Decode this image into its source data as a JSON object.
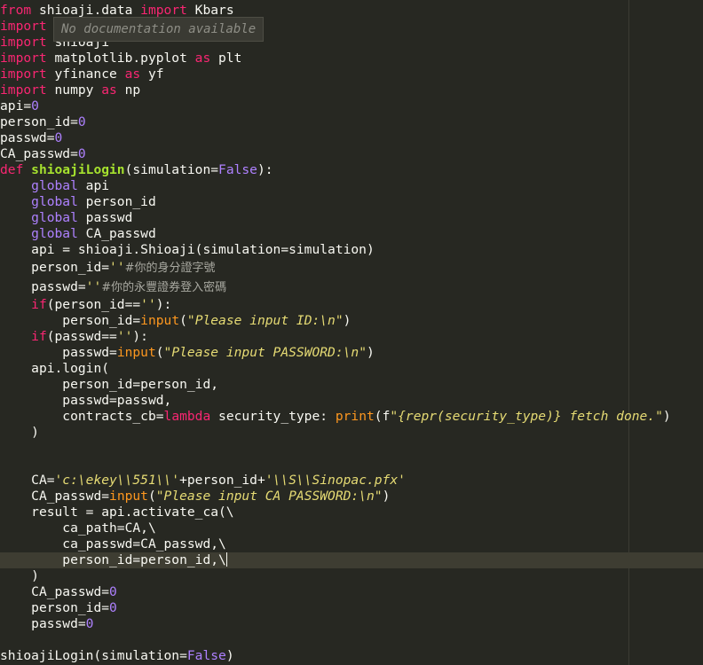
{
  "tooltip": "No documentation available",
  "code": {
    "l1": {
      "a": "from",
      "b": " shioaji.data ",
      "c": "import",
      "d": " Kbars"
    },
    "l2": {
      "a": "import"
    },
    "l3": {
      "a": "import",
      "b": " shioaji"
    },
    "l4": {
      "a": "import",
      "b": " matplotlib.pyplot ",
      "c": "as",
      "d": " plt"
    },
    "l5": {
      "a": "import",
      "b": " yfinance ",
      "c": "as",
      "d": " yf"
    },
    "l6": {
      "a": "import",
      "b": " numpy ",
      "c": "as",
      "d": " np"
    },
    "l7": {
      "a": "api=",
      "b": "0"
    },
    "l8": {
      "a": "person_id=",
      "b": "0"
    },
    "l9": {
      "a": "passwd=",
      "b": "0"
    },
    "l10": {
      "a": "CA_passwd=",
      "b": "0"
    },
    "l11": {
      "a": "def",
      "b": "shioajiLogin",
      "c": "(simulation=",
      "d": "False",
      "e": "):"
    },
    "l12": {
      "a": "global",
      "b": " api"
    },
    "l13": {
      "a": "global",
      "b": " person_id"
    },
    "l14": {
      "a": "global",
      "b": " passwd"
    },
    "l15": {
      "a": "global",
      "b": " CA_passwd"
    },
    "l16": {
      "a": "api = shioaji.Shioaji(simulation=simulation)"
    },
    "l17": {
      "a": "person_id=",
      "b": "''",
      "c": "#你的身分證字號"
    },
    "l18": {
      "a": "passwd=",
      "b": "''",
      "c": "#你的永豐證券登入密碼"
    },
    "l19": {
      "a": "if",
      "b": "(person_id==",
      "c": "''",
      "d": "):"
    },
    "l20": {
      "a": "person_id=",
      "b": "input",
      "c": "(",
      "d": "\"Please input ID:\\n\"",
      "e": ")"
    },
    "l21": {
      "a": "if",
      "b": "(passwd==",
      "c": "''",
      "d": "):"
    },
    "l22": {
      "a": "passwd=",
      "b": "input",
      "c": "(",
      "d": "\"Please input PASSWORD:\\n\"",
      "e": ")"
    },
    "l23": {
      "a": "api.login("
    },
    "l24": {
      "a": "person_id=person_id,"
    },
    "l25": {
      "a": "passwd=passwd,"
    },
    "l26": {
      "a": "contracts_cb=",
      "b": "lambda",
      "c": " security_type: ",
      "d": "print",
      "e": "(f",
      "f": "\"{repr(security_type)} fetch done.\"",
      "g": ")"
    },
    "l27": {
      "a": ")"
    },
    "l28": {
      "a": "CA=",
      "b": "'c:\\ekey\\\\551\\\\'",
      "c": "+person_id+",
      "d": "'\\\\S\\\\Sinopac.pfx'"
    },
    "l29": {
      "a": "CA_passwd=",
      "b": "input",
      "c": "(",
      "d": "\"Please input CA PASSWORD:\\n\"",
      "e": ")"
    },
    "l30": {
      "a": "result = api.activate_ca(\\"
    },
    "l31": {
      "a": "ca_path=CA,\\"
    },
    "l32": {
      "a": "ca_passwd=CA_passwd,\\"
    },
    "l33": {
      "a": "person_id=person_id,\\"
    },
    "l34": {
      "a": ")"
    },
    "l35": {
      "a": "CA_passwd=",
      "b": "0"
    },
    "l36": {
      "a": "person_id=",
      "b": "0"
    },
    "l37": {
      "a": "passwd=",
      "b": "0"
    },
    "l38": {
      "a": "shioajiLogin(simulation=",
      "b": "False",
      "c": ")"
    }
  },
  "colors": {
    "background": "#272822",
    "keyword": "#f92672",
    "number": "#ae81ff",
    "function": "#a6e22e",
    "string": "#e6db74",
    "builtin": "#fd971f"
  }
}
